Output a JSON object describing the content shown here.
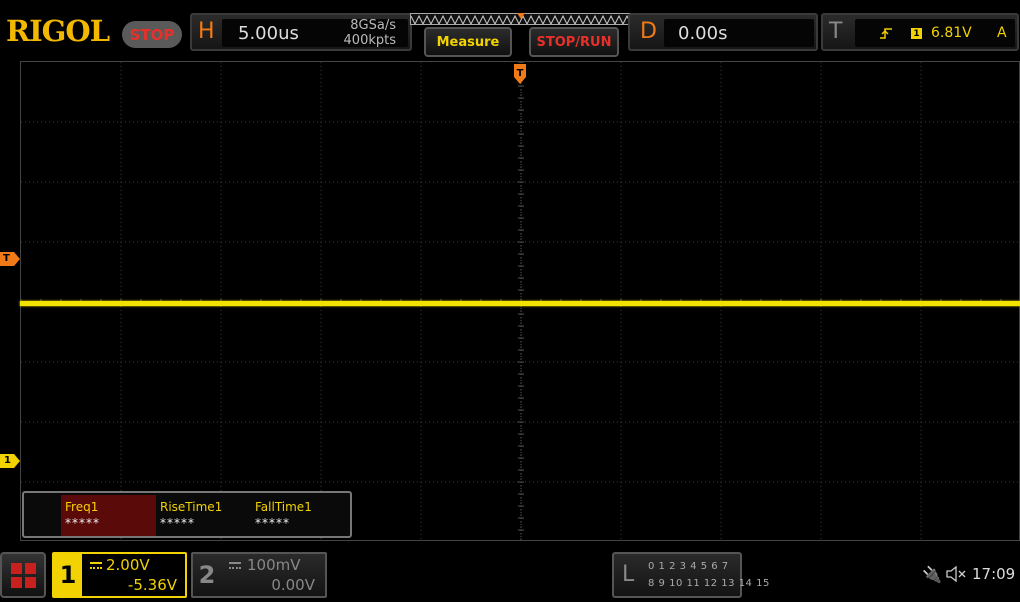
{
  "brand": {
    "logo": "RIGOL",
    "run_state": "STOP"
  },
  "horizontal": {
    "letter": "H",
    "timebase": "5.00us",
    "sample_rate": "8GSa/s",
    "memory_depth": "400kpts"
  },
  "toolbar": {
    "measure_label": "Measure",
    "stop_run_label": "STOP/RUN"
  },
  "delay": {
    "letter": "D",
    "value": "0.00s"
  },
  "trigger": {
    "letter": "T",
    "edge_icon": "rising-edge-icon",
    "source": "1",
    "level": "6.81V",
    "mode": "A"
  },
  "markers": {
    "trigger_level": "T",
    "trigger_position": "T",
    "ch1_offset": "1"
  },
  "measurements": [
    {
      "name": "Freq1",
      "value": "*****"
    },
    {
      "name": "RiseTime1",
      "value": "*****"
    },
    {
      "name": "FallTime1",
      "value": "*****"
    }
  ],
  "channels": {
    "ch1": {
      "number": "1",
      "scale": "2.00V",
      "offset": "-5.36V",
      "color": "#f2d200",
      "coupling_icon": "dc-coupling-icon"
    },
    "ch2": {
      "number": "2",
      "scale": "100mV",
      "offset": "0.00V",
      "color": "#888888",
      "coupling_icon": "dc-coupling-icon"
    }
  },
  "logic_analyzer": {
    "letter": "L",
    "row1": "0 1 2 3  4 5 6 7",
    "row2": "8 9 10 11 12 13 14 15"
  },
  "status": {
    "usb_icon": "usb-icon",
    "mute_icon": "speaker-mute-icon",
    "time": "17:09"
  },
  "colors": {
    "brand": "#f2b800",
    "accent": "#f07a17",
    "trace": "#f2e200",
    "stop": "#e8302a"
  }
}
